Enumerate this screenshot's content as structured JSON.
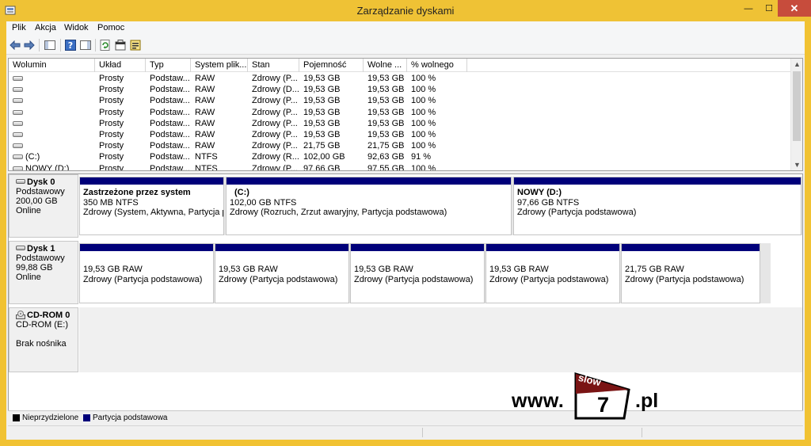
{
  "window": {
    "title": "Zarządzanie dyskami",
    "close_glyph": "✕",
    "min_glyph": "—",
    "max_glyph": "☐"
  },
  "menu": [
    "Plik",
    "Akcja",
    "Widok",
    "Pomoc"
  ],
  "toolbar_icons": [
    "back-arrow-icon",
    "forward-arrow-icon",
    "show-hide-console-tree-icon",
    "help-icon",
    "show-action-pane-icon",
    "refresh-icon",
    "properties-icon",
    "export-list-icon"
  ],
  "volume_list": {
    "columns": [
      "Wolumin",
      "Układ",
      "Typ",
      "System plik...",
      "Stan",
      "Pojemność",
      "Wolne ...",
      "% wolnego"
    ],
    "rows": [
      [
        "",
        "Prosty",
        "Podstaw...",
        "RAW",
        "Zdrowy (P...",
        "19,53 GB",
        "19,53 GB",
        "100 %"
      ],
      [
        "",
        "Prosty",
        "Podstaw...",
        "RAW",
        "Zdrowy (D...",
        "19,53 GB",
        "19,53 GB",
        "100 %"
      ],
      [
        "",
        "Prosty",
        "Podstaw...",
        "RAW",
        "Zdrowy (P...",
        "19,53 GB",
        "19,53 GB",
        "100 %"
      ],
      [
        "",
        "Prosty",
        "Podstaw...",
        "RAW",
        "Zdrowy (P...",
        "19,53 GB",
        "19,53 GB",
        "100 %"
      ],
      [
        "",
        "Prosty",
        "Podstaw...",
        "RAW",
        "Zdrowy (P...",
        "19,53 GB",
        "19,53 GB",
        "100 %"
      ],
      [
        "",
        "Prosty",
        "Podstaw...",
        "RAW",
        "Zdrowy (P...",
        "19,53 GB",
        "19,53 GB",
        "100 %"
      ],
      [
        "",
        "Prosty",
        "Podstaw...",
        "RAW",
        "Zdrowy (P...",
        "21,75 GB",
        "21,75 GB",
        "100 %"
      ],
      [
        "(C:)",
        "Prosty",
        "Podstaw...",
        "NTFS",
        "Zdrowy (R...",
        "102,00 GB",
        "92,63 GB",
        "91 %"
      ],
      [
        "NOWY (D:)",
        "Prosty",
        "Podstaw...",
        "NTFS",
        "Zdrowy (P...",
        "97,66 GB",
        "97,55 GB",
        "100 %"
      ]
    ]
  },
  "disks": [
    {
      "name": "Dysk 0",
      "type": "Podstawowy",
      "size": "200,00 GB",
      "status": "Online",
      "partitions": [
        {
          "title": "Zastrzeżone przez system",
          "size": "350 MB NTFS",
          "state": "Zdrowy (System, Aktywna, Partycja podstawowa)"
        },
        {
          "title": "(C:)",
          "size": "102,00 GB NTFS",
          "state": "Zdrowy (Rozruch, Zrzut awaryjny, Partycja podstawowa)"
        },
        {
          "title": "NOWY  (D:)",
          "size": "97,66 GB NTFS",
          "state": "Zdrowy (Partycja podstawowa)"
        }
      ]
    },
    {
      "name": "Dysk 1",
      "type": "Podstawowy",
      "size": "99,88 GB",
      "status": "Online",
      "partitions": [
        {
          "title": "",
          "size": "19,53 GB RAW",
          "state": "Zdrowy (Partycja podstawowa)"
        },
        {
          "title": "",
          "size": "19,53 GB RAW",
          "state": "Zdrowy (Partycja podstawowa)"
        },
        {
          "title": "",
          "size": "19,53 GB RAW",
          "state": "Zdrowy (Partycja podstawowa)"
        },
        {
          "title": "",
          "size": "19,53 GB RAW",
          "state": "Zdrowy (Partycja podstawowa)"
        },
        {
          "title": "",
          "size": "21,75 GB RAW",
          "state": "Zdrowy (Partycja podstawowa)"
        }
      ]
    },
    {
      "name": "CD-ROM 0",
      "type": "CD-ROM (E:)",
      "size": "",
      "status": "Brak nośnika",
      "partitions": []
    }
  ],
  "legend": [
    {
      "label": "Nieprzydzielone",
      "color": "#000000"
    },
    {
      "label": "Partycja podstawowa",
      "color": "#00007a"
    }
  ],
  "watermark": {
    "prefix": "www.",
    "flag_text": "slow",
    "number": "7",
    "suffix": ".pl"
  },
  "colors": {
    "frame": "#f1c232",
    "close": "#c74c3c",
    "partition_bar": "#00007a"
  }
}
